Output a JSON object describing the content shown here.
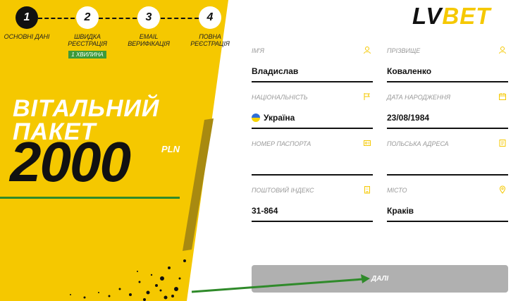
{
  "steps": [
    {
      "number": "1",
      "label": "ОСНОВНІ ДАНІ",
      "active": true
    },
    {
      "number": "2",
      "label": "ШВИДКА РЕЄСТРАЦІЯ",
      "badge": "1 ХВИЛИНА",
      "active": false
    },
    {
      "number": "3",
      "label": "EMAIL ВЕРИФІКАЦІЯ",
      "active": false
    },
    {
      "number": "4",
      "label": "ПОВНА РЕЄСТРАЦІЯ",
      "active": false
    }
  ],
  "promo": {
    "line1": "ВІТАЛЬНИЙ",
    "line2": "ПАКЕТ",
    "amount": "2000",
    "currency": "PLN"
  },
  "logo": {
    "part1": "LV",
    "part2": "BET"
  },
  "form": {
    "first_name": {
      "label": "ІМ'Я",
      "value": "Владислав",
      "icon": "user-icon"
    },
    "last_name": {
      "label": "ПРІЗВИЩЕ",
      "value": "Коваленко",
      "icon": "user-icon"
    },
    "nationality": {
      "label": "НАЦІОНАЛЬНІСТЬ",
      "value": "Україна",
      "icon": "flag-icon"
    },
    "birth_date": {
      "label": "ДАТА НАРОДЖЕННЯ",
      "value": "23/08/1984",
      "icon": "calendar-icon"
    },
    "passport": {
      "label": "НОМЕР ПАСПОРТА",
      "value": "",
      "icon": "passport-icon"
    },
    "polish_address": {
      "label": "ПОЛЬСЬКА АДРЕСА",
      "value": "",
      "icon": "address-icon"
    },
    "postal_code": {
      "label": "ПОШТОВИЙ ІНДЕКС",
      "value": "31-864",
      "icon": "building-icon"
    },
    "city": {
      "label": "МІСТО",
      "value": "Краків",
      "icon": "location-icon"
    }
  },
  "next_button": {
    "label": "ДАЛІ"
  },
  "colors": {
    "brand_yellow": "#f5c800",
    "accent_green": "#2f8a2a",
    "button_gray": "#b0b0b0"
  }
}
